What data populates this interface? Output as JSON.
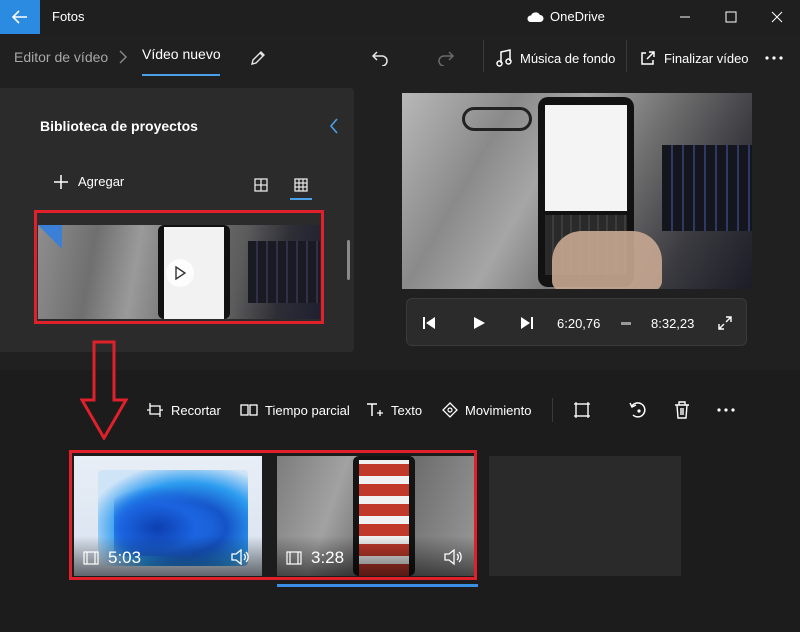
{
  "window": {
    "title": "Fotos",
    "cloud_label": "OneDrive"
  },
  "header": {
    "breadcrumb_parent": "Editor de vídeo",
    "breadcrumb_current": "Vídeo nuevo",
    "background_music_label": "Música de fondo",
    "finish_video_label": "Finalizar vídeo"
  },
  "library": {
    "title": "Biblioteca de proyectos",
    "add_label": "Agregar"
  },
  "player": {
    "current_time": "6:20,76",
    "total_time": "8:32,23"
  },
  "storyboard": {
    "toolbar": {
      "trim_label": "Recortar",
      "split_label": "Tiempo parcial",
      "text_label": "Texto",
      "motion_label": "Movimiento"
    },
    "clips": [
      {
        "duration": "5:03"
      },
      {
        "duration": "3:28"
      }
    ]
  },
  "colors": {
    "accent": "#2a8be0",
    "highlight_red": "#e0202a",
    "selection_blue": "#3a8ee6"
  },
  "icons": [
    "back-arrow-icon",
    "onedrive-cloud-icon",
    "minimize-icon",
    "maximize-icon",
    "close-icon",
    "pencil-icon",
    "undo-icon",
    "redo-icon",
    "music-note-icon",
    "share-export-icon",
    "more-icon",
    "chevron-left-icon",
    "plus-icon",
    "grid-small-icon",
    "grid-large-icon",
    "play-icon",
    "skip-back-icon",
    "skip-forward-icon",
    "fullscreen-icon",
    "trim-icon",
    "split-icon",
    "text-icon",
    "motion-icon",
    "resize-icon",
    "rotate-icon",
    "delete-icon",
    "film-icon",
    "volume-icon"
  ]
}
